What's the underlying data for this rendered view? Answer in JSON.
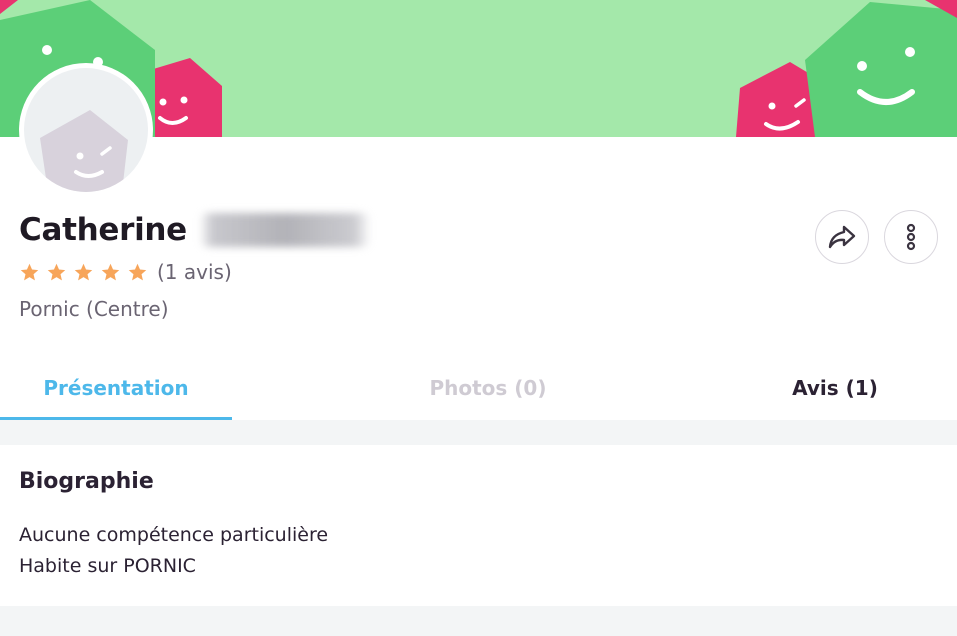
{
  "profile": {
    "first_name": "Catherine",
    "rating": 5,
    "rating_max": 5,
    "review_count_label": "(1 avis)",
    "location": "Pornic (Centre)"
  },
  "actions": {
    "share_icon": "share-icon",
    "more_icon": "more-vertical-icon"
  },
  "tabs": [
    {
      "label": "Présentation",
      "active": true
    },
    {
      "label": "Photos (0)",
      "active": false,
      "disabled": true
    },
    {
      "label": "Avis (1)",
      "active": false
    }
  ],
  "bio": {
    "title": "Biographie",
    "lines": [
      "Aucune compétence particulière",
      "Habite sur PORNIC"
    ]
  },
  "colors": {
    "accent": "#4db8ea",
    "star": "#f7a55a",
    "banner_green": "#a4e8aa",
    "banner_pink": "#e8336f"
  }
}
